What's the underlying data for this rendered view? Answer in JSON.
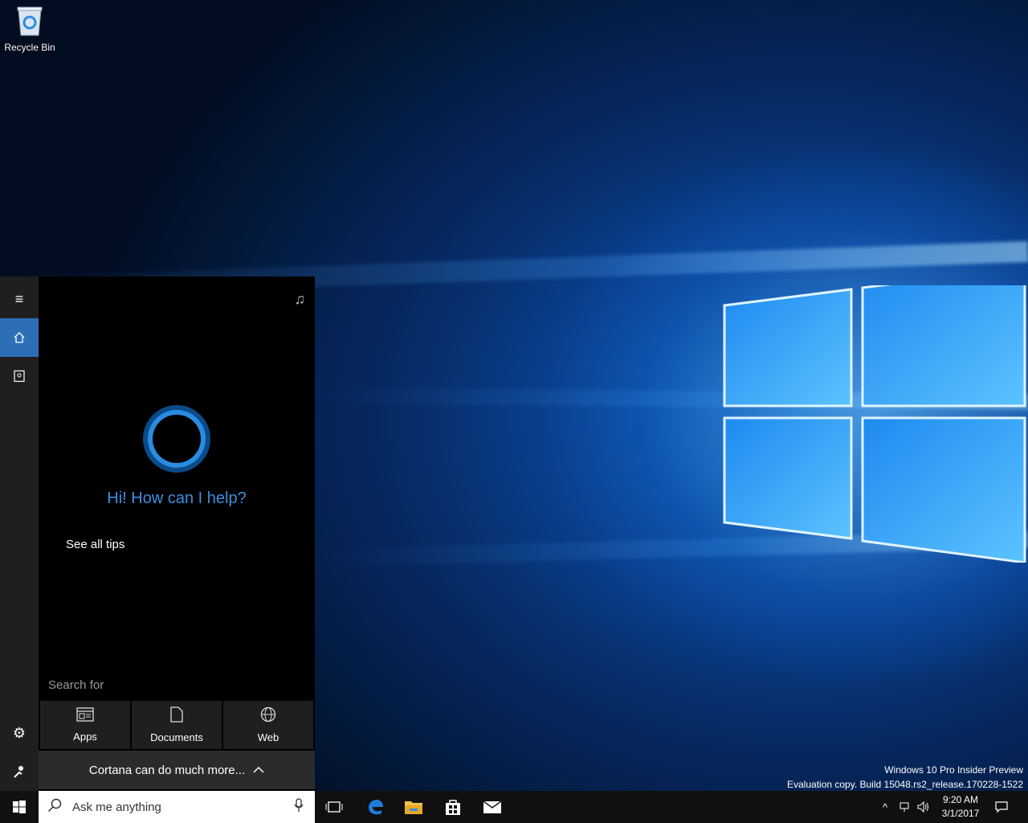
{
  "desktop": {
    "icons": [
      {
        "label": "Recycle Bin",
        "icon": "recycle-bin-icon"
      }
    ],
    "watermark": {
      "line1": "Windows 10 Pro Insider Preview",
      "line2": "Evaluation copy. Build 15048.rs2_release.170228-1522"
    }
  },
  "cortana": {
    "rail": {
      "items": [
        {
          "name": "hamburger-menu-icon",
          "active": false
        },
        {
          "name": "home-icon",
          "active": true
        },
        {
          "name": "notebook-icon",
          "active": false
        },
        {
          "name": "settings-icon",
          "active": false
        },
        {
          "name": "feedback-icon",
          "active": false
        }
      ]
    },
    "greeting": "Hi! How can I help?",
    "tips_link": "See all tips",
    "search_for_label": "Search for",
    "filters": [
      {
        "label": "Apps",
        "icon": "apps-icon"
      },
      {
        "label": "Documents",
        "icon": "document-icon"
      },
      {
        "label": "Web",
        "icon": "globe-icon"
      }
    ],
    "more_label": "Cortana can do much more...",
    "accent": "#2d6fb7"
  },
  "taskbar": {
    "search_placeholder": "Ask me anything",
    "pinned": [
      "task-view-icon",
      "edge-icon",
      "file-explorer-icon",
      "store-icon",
      "mail-icon"
    ],
    "clock": {
      "time": "9:20 AM",
      "date": "3/1/2017"
    }
  }
}
